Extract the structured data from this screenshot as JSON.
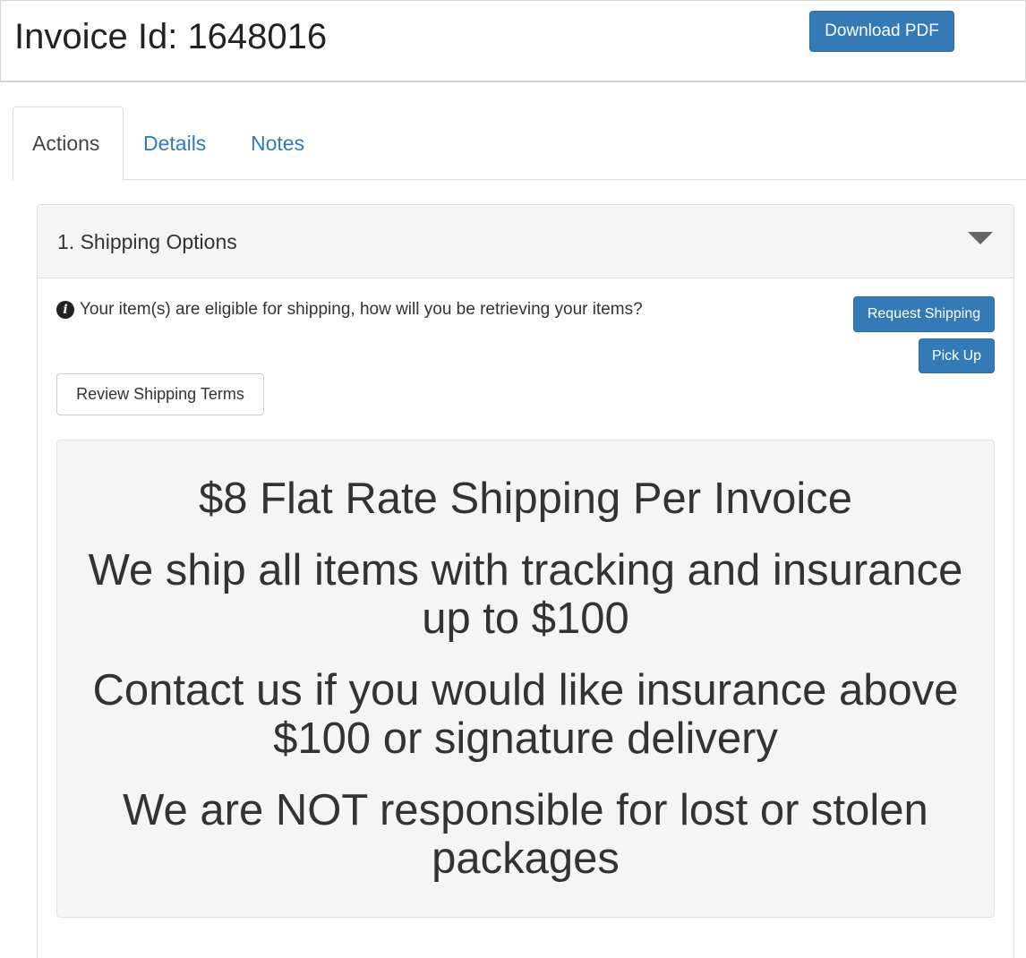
{
  "header": {
    "title": "Invoice Id: 1648016",
    "download_label": "Download PDF"
  },
  "tabs": [
    {
      "label": "Actions",
      "active": true
    },
    {
      "label": "Details",
      "active": false
    },
    {
      "label": "Notes",
      "active": false
    }
  ],
  "panel": {
    "title": "1. Shipping Options",
    "info_text": "Your item(s) are eligible for shipping, how will you be retrieving your items?",
    "request_shipping_label": "Request Shipping",
    "pick_up_label": "Pick Up",
    "review_terms_label": "Review Shipping Terms",
    "terms": [
      "$8 Flat Rate Shipping Per Invoice",
      "We ship all items with tracking and insurance up to $100",
      "Contact us if you would like insurance above $100 or signature delivery",
      "We are NOT responsible for lost or stolen packages"
    ]
  },
  "colors": {
    "primary": "#337ab7",
    "link": "#337ab7",
    "panel_bg": "#f5f5f5",
    "text": "#333333"
  },
  "icons": {
    "info": "info-circle-icon",
    "collapse": "caret-down-icon"
  }
}
